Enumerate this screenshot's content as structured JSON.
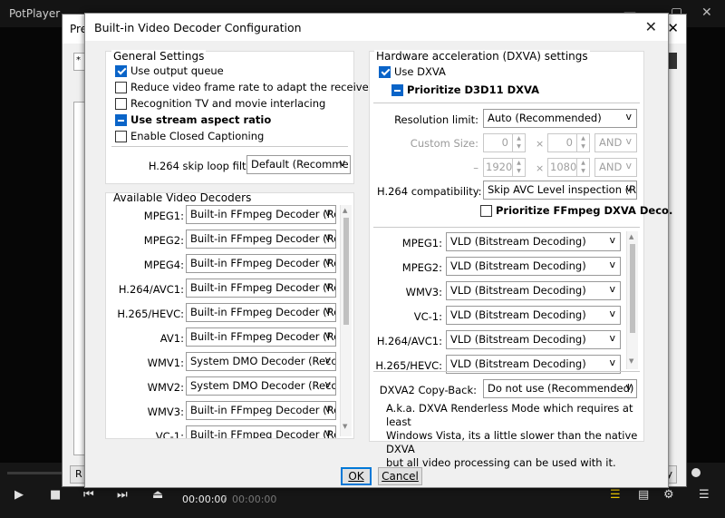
{
  "player": {
    "title": "PotPlayer",
    "time_current": "00:00:00",
    "time_separator": "/",
    "time_total": "00:00:00"
  },
  "pref_window": {
    "title": "Pre",
    "input_value": "*",
    "left_button": "R",
    "right_button": "ly"
  },
  "dialog": {
    "title": "Built-in Video Decoder Configuration",
    "close_glyph": "✕",
    "general": {
      "title": "General Settings",
      "use_output_queue": "Use output queue",
      "reduce_frame_rate": "Reduce video frame rate to adapt the receiver",
      "recognition_interlacing": "Recognition TV and movie interlacing",
      "use_stream_aspect": "Use stream aspect ratio",
      "enable_cc": "Enable Closed Captioning",
      "h264_skip_label": "H.264 skip loop filter:",
      "h264_skip_value": "Default (Recomme"
    },
    "decoders": {
      "title": "Available Video Decoders",
      "rows": [
        {
          "label": "MPEG1:",
          "value": "Built-in FFmpeg Decoder (Re"
        },
        {
          "label": "MPEG2:",
          "value": "Built-in FFmpeg Decoder (Re"
        },
        {
          "label": "MPEG4:",
          "value": "Built-in FFmpeg Decoder (Re"
        },
        {
          "label": "H.264/AVC1:",
          "value": "Built-in FFmpeg Decoder (Re"
        },
        {
          "label": "H.265/HEVC:",
          "value": "Built-in FFmpeg Decoder (Re"
        },
        {
          "label": "AV1:",
          "value": "Built-in FFmpeg Decoder (Re"
        },
        {
          "label": "WMV1:",
          "value": "System DMO Decoder (Reco"
        },
        {
          "label": "WMV2:",
          "value": "System DMO Decoder (Reco"
        },
        {
          "label": "WMV3:",
          "value": "Built-in FFmpeg Decoder (Re"
        },
        {
          "label": "VC-1:",
          "value": "Built-in FFmpeg Decoder (Re"
        }
      ]
    },
    "hw": {
      "title": "Hardware acceleration (DXVA) settings",
      "use_dxva": "Use DXVA",
      "prioritize_d3d11": "Prioritize D3D11 DXVA",
      "resolution_label": "Resolution limit:",
      "resolution_value": "Auto (Recommended)",
      "custom_size_label": "Custom Size:",
      "custom_w": "0",
      "custom_h": "0",
      "custom_op": "AND",
      "dash": "–",
      "max_w": "1920",
      "max_h": "1080",
      "max_op": "AND",
      "times": "×",
      "h264_compat_label": "H.264 compatibility:",
      "h264_compat_value": "Skip AVC Level inspection (Re",
      "prioritize_ffmpeg": "Prioritize FFmpeg DXVA Deco.",
      "rows": [
        {
          "label": "MPEG1:",
          "value": "VLD (Bitstream Decoding)"
        },
        {
          "label": "MPEG2:",
          "value": "VLD (Bitstream Decoding)"
        },
        {
          "label": "WMV3:",
          "value": "VLD (Bitstream Decoding)"
        },
        {
          "label": "VC-1:",
          "value": "VLD (Bitstream Decoding)"
        },
        {
          "label": "H.264/AVC1:",
          "value": "VLD (Bitstream Decoding)"
        },
        {
          "label": "H.265/HEVC:",
          "value": "VLD (Bitstream Decoding)"
        }
      ],
      "copyback_label": "DXVA2 Copy-Back:",
      "copyback_value": "Do not use (Recommended)",
      "description_lines": [
        "A.k.a. DXVA Renderless Mode which requires at least",
        "Windows Vista, its a little slower than the native DXVA",
        "but all video processing can be used with it."
      ]
    },
    "buttons": {
      "ok": "OK",
      "cancel": "Cancel"
    },
    "combo_arrow": "v"
  }
}
